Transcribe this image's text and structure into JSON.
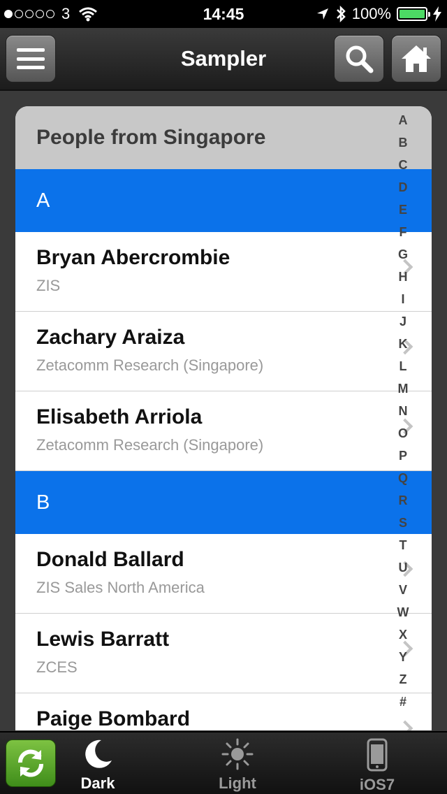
{
  "status_bar": {
    "carrier": "3",
    "time": "14:45",
    "battery": "100%"
  },
  "nav": {
    "title": "Sampler"
  },
  "list": {
    "header": "People from Singapore",
    "sections": [
      {
        "letter": "A",
        "rows": [
          {
            "name": "Bryan Abercrombie",
            "company": "ZIS"
          },
          {
            "name": "Zachary Araiza",
            "company": "Zetacomm Research (Singapore)"
          },
          {
            "name": "Elisabeth Arriola",
            "company": "Zetacomm Research (Singapore)"
          }
        ]
      },
      {
        "letter": "B",
        "rows": [
          {
            "name": "Donald Ballard",
            "company": "ZIS Sales North America"
          },
          {
            "name": "Lewis Barratt",
            "company": "ZCES"
          },
          {
            "name": "Paige Bombard",
            "company": ""
          }
        ]
      }
    ],
    "index": [
      "A",
      "B",
      "C",
      "D",
      "E",
      "F",
      "G",
      "H",
      "I",
      "J",
      "K",
      "L",
      "M",
      "N",
      "O",
      "P",
      "Q",
      "R",
      "S",
      "T",
      "U",
      "V",
      "W",
      "X",
      "Y",
      "Z",
      "#"
    ]
  },
  "tabs": {
    "dark": "Dark",
    "light": "Light",
    "ios7": "iOS7"
  },
  "colors": {
    "section_header": "#0b72ea",
    "refresh_button": "#5aa62e",
    "battery_fill": "#4cd964"
  }
}
